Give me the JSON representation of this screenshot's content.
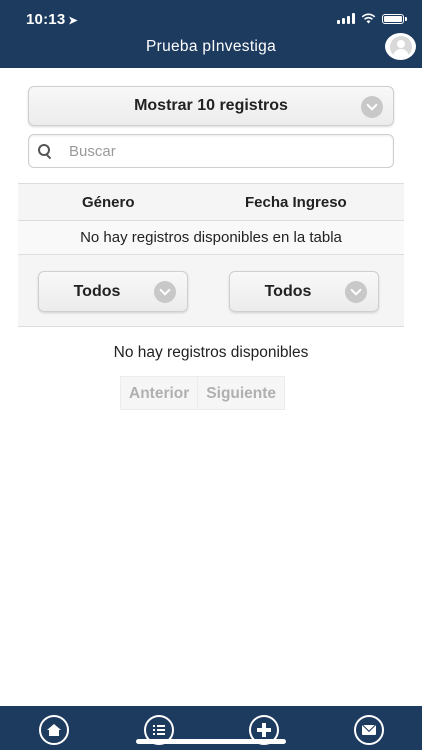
{
  "status_bar": {
    "time": "10:13",
    "location_icon": "location-arrow-icon",
    "signal_icon": "cellular-signal-icon",
    "wifi_icon": "wifi-icon",
    "battery_icon": "battery-icon"
  },
  "header": {
    "title": "Prueba pInvestiga",
    "avatar_icon": "user-avatar-icon",
    "background": "#1d3a5f"
  },
  "controls": {
    "page_length_label": "Mostrar 10 registros",
    "search_placeholder": "Buscar",
    "search_value": ""
  },
  "table": {
    "columns": [
      "Género",
      "Fecha Ingreso"
    ],
    "empty_message": "No hay registros disponibles en la tabla",
    "filters": [
      "Todos",
      "Todos"
    ]
  },
  "footer": {
    "info": "No hay registros disponibles",
    "prev_label": "Anterior",
    "next_label": "Siguiente"
  },
  "tab_bar": {
    "icons": [
      "home-icon",
      "list-icon",
      "add-icon",
      "mail-icon"
    ]
  }
}
